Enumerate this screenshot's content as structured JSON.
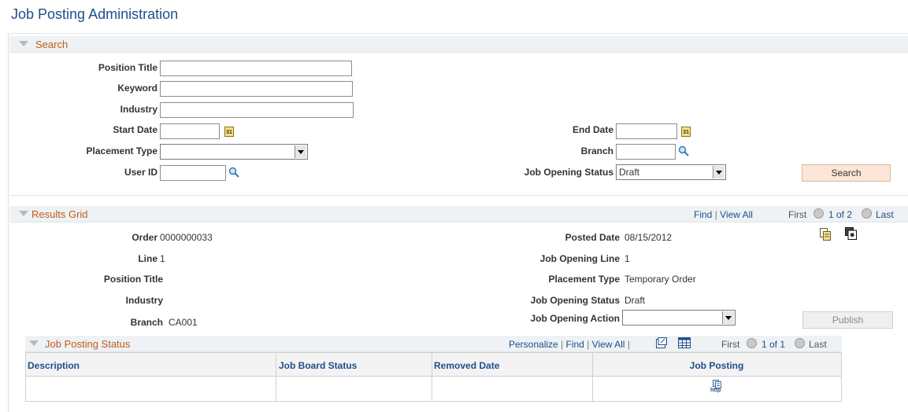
{
  "page_title": "Job Posting Administration",
  "search": {
    "section_title": "Search",
    "fields": {
      "position_title": {
        "label": "Position Title",
        "value": ""
      },
      "keyword": {
        "label": "Keyword",
        "value": ""
      },
      "industry": {
        "label": "Industry",
        "value": ""
      },
      "start_date": {
        "label": "Start Date",
        "value": ""
      },
      "end_date": {
        "label": "End Date",
        "value": ""
      },
      "placement_type": {
        "label": "Placement Type",
        "value": ""
      },
      "branch": {
        "label": "Branch",
        "value": ""
      },
      "user_id": {
        "label": "User ID",
        "value": ""
      },
      "job_opening_status": {
        "label": "Job Opening Status",
        "value": "Draft"
      }
    },
    "search_button": "Search",
    "calendar_icon_text": "31"
  },
  "results": {
    "section_title": "Results Grid",
    "links": {
      "find": "Find",
      "sep": "|",
      "view_all": "View All"
    },
    "pager": {
      "first": "First",
      "range": "1 of 2",
      "last": "Last"
    },
    "fields": {
      "order": {
        "label": "Order",
        "value": "0000000033"
      },
      "posted_date": {
        "label": "Posted Date",
        "value": "08/15/2012"
      },
      "line": {
        "label": "Line",
        "value": "1"
      },
      "job_opening_line": {
        "label": "Job Opening Line",
        "value": "1"
      },
      "position_title": {
        "label": "Position Title",
        "value": ""
      },
      "placement_type": {
        "label": "Placement Type",
        "value": "Temporary Order"
      },
      "industry": {
        "label": "Industry",
        "value": ""
      },
      "job_opening_status": {
        "label": "Job Opening Status",
        "value": "Draft"
      },
      "branch": {
        "label": "Branch",
        "value": "CA001"
      },
      "job_opening_action": {
        "label": "Job Opening Action",
        "value": ""
      }
    },
    "publish_button": "Publish"
  },
  "posting_status": {
    "section_title": "Job Posting Status",
    "links": {
      "personalize": "Personalize",
      "sep": "|",
      "find": "Find",
      "view_all": "View All"
    },
    "pager": {
      "first": "First",
      "range": "1 of 1",
      "last": "Last"
    },
    "columns": [
      "Description",
      "Job Board Status",
      "Removed Date",
      "Job Posting"
    ],
    "row": {
      "description": "",
      "job_board_status": "",
      "removed_date": "",
      "job_posting_icon_text": "http"
    }
  }
}
